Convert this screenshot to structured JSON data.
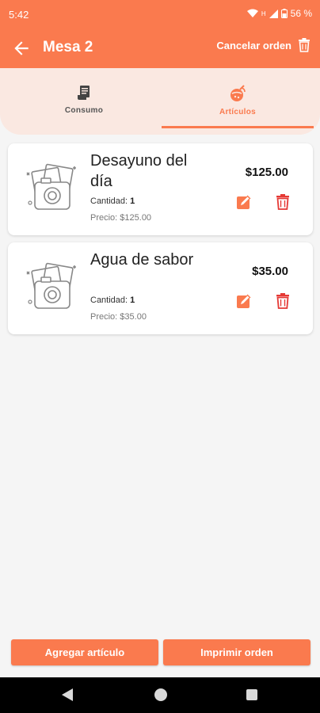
{
  "status": {
    "time": "5:42",
    "battery": "56 %",
    "network": "H"
  },
  "header": {
    "title": "Mesa 2",
    "cancel_label": "Cancelar orden"
  },
  "tabs": [
    {
      "label": "Consumo",
      "icon": "receipt-icon",
      "active": false
    },
    {
      "label": "Artículos",
      "icon": "food-icon",
      "active": true
    }
  ],
  "items": [
    {
      "name": "Desayuno del día",
      "quantity_label": "Cantidad:",
      "quantity": "1",
      "price_line": "Precio: $125.00",
      "total": "$125.00"
    },
    {
      "name": "Agua de sabor",
      "quantity_label": "Cantidad:",
      "quantity": "1",
      "price_line": "Precio: $35.00",
      "total": "$35.00"
    }
  ],
  "actions": {
    "add_label": "Agregar artículo",
    "print_label": "Imprimir orden"
  },
  "colors": {
    "accent": "#fa7a4e",
    "tab_bg": "#fae8e1",
    "delete": "#e53935"
  }
}
